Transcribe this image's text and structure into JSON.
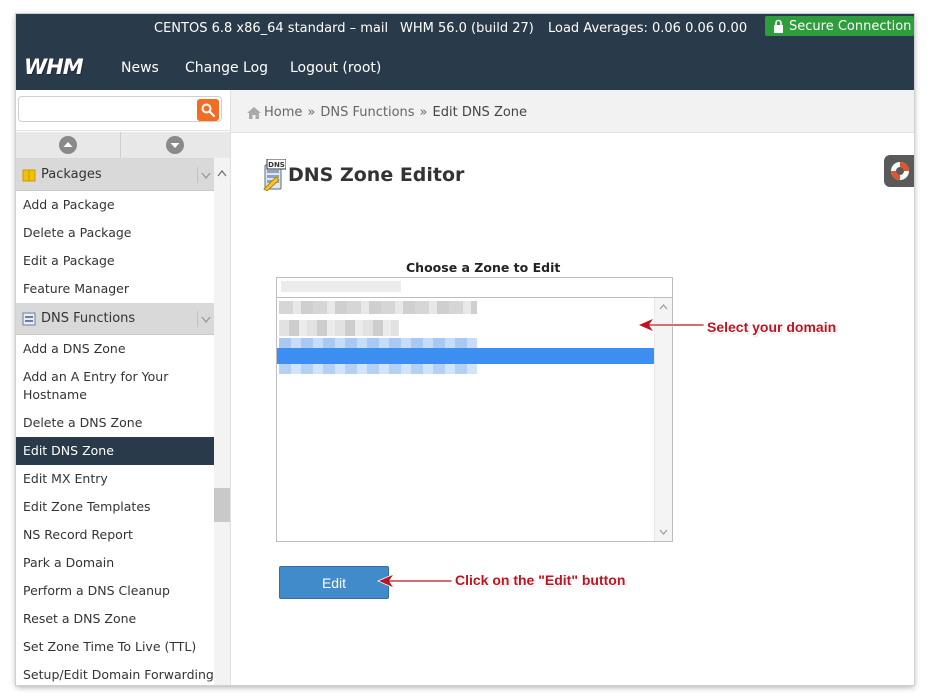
{
  "header": {
    "os": "CENTOS 6.8 x86_64 standard – mail",
    "version": "WHM 56.0 (build 27)",
    "load": "Load Averages: 0.06 0.06 0.00",
    "secure": "Secure Connection",
    "logo": "WHM",
    "nav": [
      "News",
      "Change Log",
      "Logout (root)"
    ]
  },
  "sidebar": {
    "search_value": "",
    "groups": [
      {
        "title": "Packages",
        "items": [
          "Add a Package",
          "Delete a Package",
          "Edit a Package",
          "Feature Manager"
        ]
      },
      {
        "title": "DNS Functions",
        "items": [
          "Add a DNS Zone",
          "Add an A Entry for Your Hostname",
          "Delete a DNS Zone",
          "Edit DNS Zone",
          "Edit MX Entry",
          "Edit Zone Templates",
          "NS Record Report",
          "Park a Domain",
          "Perform a DNS Cleanup",
          "Reset a DNS Zone",
          "Set Zone Time To Live (TTL)",
          "Setup/Edit Domain Forwarding"
        ]
      }
    ]
  },
  "breadcrumb": [
    "Home",
    "DNS Functions",
    "Edit DNS Zone"
  ],
  "breadcrumb_sep": "»",
  "page": {
    "title": "DNS Zone Editor",
    "icon_text": "DNS",
    "zone_label": "Choose a Zone to Edit",
    "edit_button": "Edit"
  },
  "annotations": {
    "select": "Select your domain",
    "click": "Click on the \"Edit\" button"
  },
  "colors": {
    "header_bg": "#293a4a",
    "secure_green": "#2e9d3c",
    "search_orange": "#f36c21",
    "active_item": "#293a4a",
    "button_blue": "#428bca",
    "selection_blue": "#3c8ef0",
    "annotation_red": "#c1121f"
  }
}
